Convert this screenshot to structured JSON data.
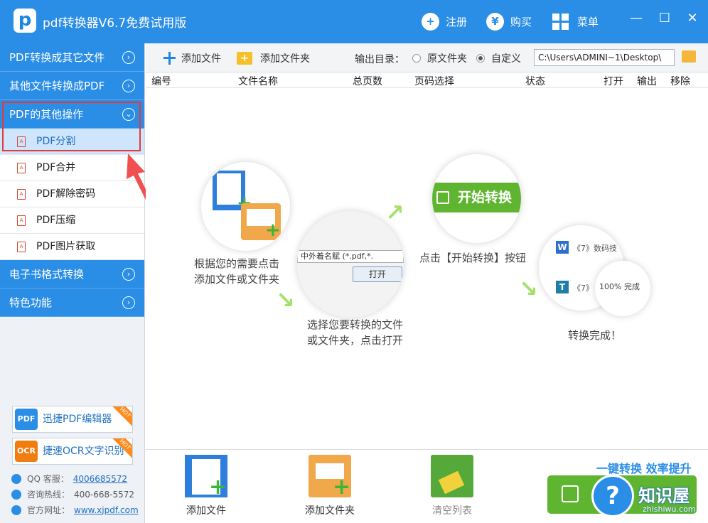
{
  "titlebar": {
    "app_icon_letter": "p",
    "title": "pdf转换器V6.7免费试用版",
    "register": "注册",
    "buy": "购买",
    "menu": "菜单",
    "minimize": "—",
    "maximize": "☐",
    "close": "✕"
  },
  "sidebar": {
    "categories": [
      {
        "label": "PDF转换成其它文件"
      },
      {
        "label": "其他文件转换成PDF"
      },
      {
        "label": "PDF的其他操作"
      },
      {
        "label": "电子书格式转换"
      },
      {
        "label": "特色功能"
      }
    ],
    "sub_items": [
      {
        "label": "PDF分割"
      },
      {
        "label": "PDF合并"
      },
      {
        "label": "PDF解除密码"
      },
      {
        "label": "PDF压缩"
      },
      {
        "label": "PDF图片获取"
      }
    ],
    "promo1": "迅捷PDF编辑器",
    "promo2": "捷速OCR文字识别",
    "hot": "HOT",
    "pdf_small": "PDF",
    "ocr_small": "OCR",
    "qq_label": "QQ 客服：",
    "qq_value": "4006685572",
    "hotline_label": "咨询热线：",
    "hotline_value": "400-668-5572",
    "site_label": "官方网址：",
    "site_value": "www.xjpdf.com"
  },
  "toolbar": {
    "add_file": "添加文件",
    "add_folder": "添加文件夹",
    "output_label": "输出目录：",
    "radio_original": "原文件夹",
    "radio_custom": "自定义",
    "path": "C:\\Users\\ADMINI~1\\Desktop\\"
  },
  "table_headers": [
    "编号",
    "文件名称",
    "总页数",
    "页码选择",
    "状态",
    "打开",
    "输出",
    "移除"
  ],
  "steps": {
    "step1": [
      "根据您的需要点击",
      "添加文件或文件夹"
    ],
    "step2": [
      "选择您要转换的文件",
      "或文件夹，点击打开"
    ],
    "step3": "点击【开始转换】按钮",
    "step4": "转换完成！",
    "dialog_filename": "中外着名赋",
    "dialog_filter": "(*.pdf,*.",
    "dialog_open": "打开",
    "start_label": "开始转换",
    "item1": "《7》数码技",
    "item2": "《7》",
    "progress": "100%",
    "done": "完成"
  },
  "bottom": {
    "add_file": "添加文件",
    "add_folder": "添加文件夹",
    "clear_list": "清空列表",
    "slogan": "一键转换  效率提升"
  },
  "watermark": {
    "mark": "?",
    "cn": "知识屋",
    "en": "zhishiwu.com"
  },
  "colors": {
    "brand_blue": "#2a8de6",
    "active_highlight": "#e23b3b",
    "start_green": "#5fb52f"
  }
}
